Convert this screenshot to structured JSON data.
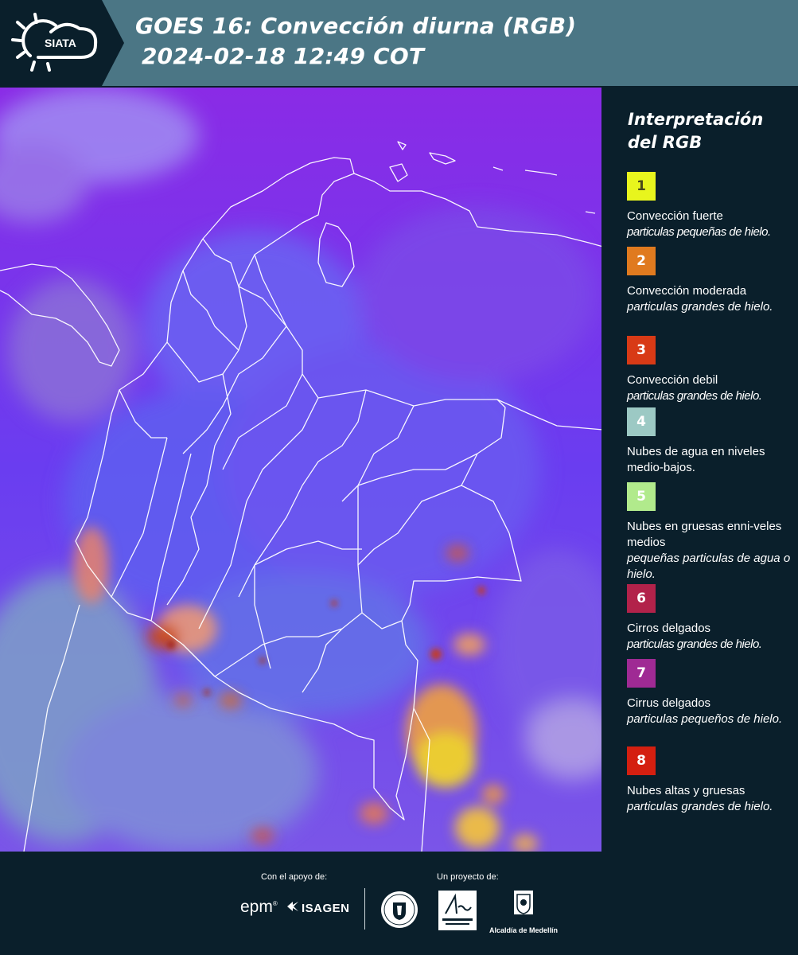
{
  "header": {
    "logo_text": "SIATA",
    "title_line1": "GOES 16: Convección diurna (RGB)",
    "title_line2": "2024-02-18 12:49 COT"
  },
  "map": {
    "base_color": "#7b2fe0"
  },
  "legend": {
    "title": "Interpretación del RGB",
    "items": [
      {
        "number": "1",
        "color": "#e8f51d",
        "text_color": "#4a4a1a",
        "label": "Convección fuerte",
        "desc": "particulas pequeñas de hielo."
      },
      {
        "number": "2",
        "color": "#e07a1f",
        "text_color": "#ffffff",
        "label": "Convección moderada",
        "desc": "particulas grandes de hielo."
      },
      {
        "number": "3",
        "color": "#d83a16",
        "text_color": "#ffffff",
        "label": "Convección debil",
        "desc": "particulas grandes de hielo."
      },
      {
        "number": "4",
        "color": "#9cc9c4",
        "text_color": "#ffffff",
        "label": "Nubes de agua en niveles medio-bajos.",
        "desc": ""
      },
      {
        "number": "5",
        "color": "#b1ea8c",
        "text_color": "#ffffff",
        "label": "Nubes en gruesas enni-veles medios",
        "desc": "pequeñas particulas de agua o hielo."
      },
      {
        "number": "6",
        "color": "#b2224a",
        "text_color": "#ffffff",
        "label": "Cirros delgados",
        "desc": "particulas grandes de hielo."
      },
      {
        "number": "7",
        "color": "#9f2a94",
        "text_color": "#ffffff",
        "label": "Cirrus delgados",
        "desc": "particulas pequeños de hielo."
      },
      {
        "number": "8",
        "color": "#d41f10",
        "text_color": "#ffffff",
        "label": "Nubes altas y gruesas",
        "desc": "particulas grandes de hielo."
      }
    ]
  },
  "footer": {
    "support_label": "Con el apoyo de:",
    "project_label": "Un proyecto de:",
    "epm": "epm",
    "isagen": "ISAGEN",
    "medellin": "Alcaldía de Medellín"
  }
}
